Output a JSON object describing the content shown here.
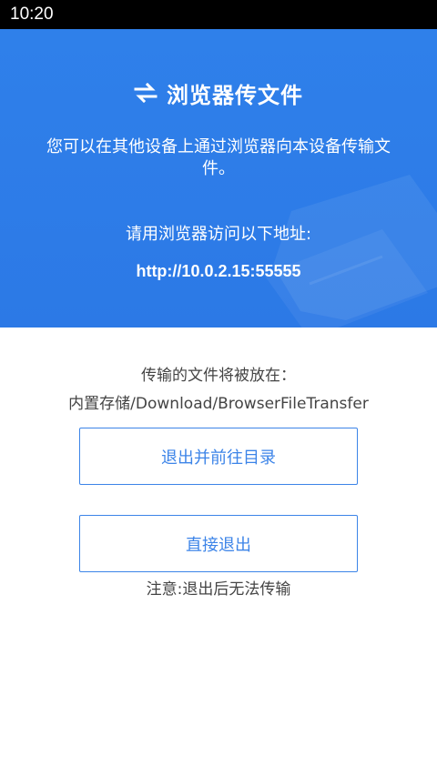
{
  "status_bar": {
    "time": "10:20"
  },
  "hero": {
    "icon": "transfer-arrows-icon",
    "title": "浏览器传文件",
    "description": "您可以在其他设备上通过浏览器向本设备传输文件。",
    "visit_label": "请用浏览器访问以下地址:",
    "url": "http://10.0.2.15:55555",
    "background_color": "#2f80ea"
  },
  "save_location": {
    "label": "传输的文件将被放在：",
    "path": "内置存储/Download/BrowserFileTransfer"
  },
  "buttons": {
    "exit_and_open": "退出并前往目录",
    "exit_directly": "直接退出"
  },
  "note": "注意:退出后无法传输",
  "accent_color": "#3c84e8"
}
